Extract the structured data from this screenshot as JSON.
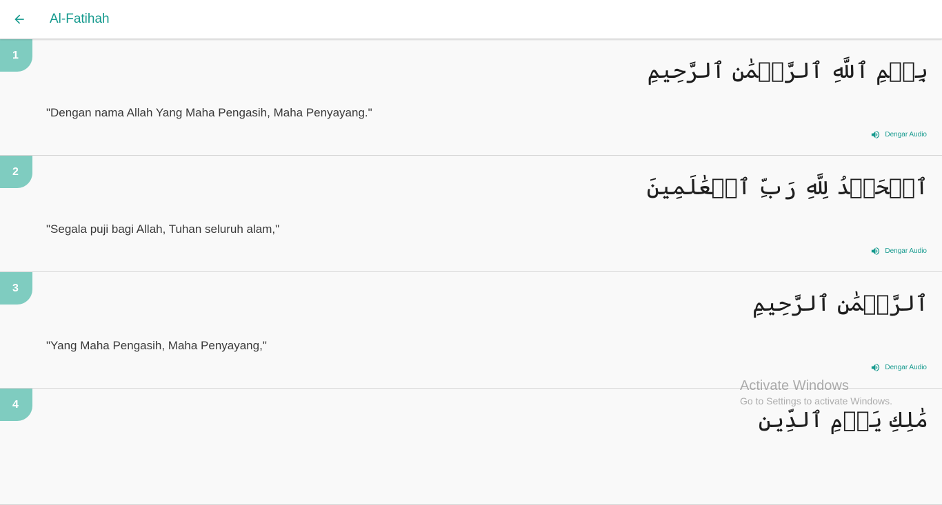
{
  "header": {
    "title": "Al-Fatihah",
    "back_icon": "arrow-left-icon"
  },
  "colors": {
    "accent": "#169a8e",
    "badge": "#7fccc0",
    "background": "#f9f9f9"
  },
  "ayahs": [
    {
      "number": "1",
      "arabic": "بِسۡمِ ٱللَّهِ ٱلرَّحۡمَٰنِ ٱلرَّحِيمِ",
      "translation": "\"Dengan nama Allah Yang Maha Pengasih, Maha Penyayang.\"",
      "audio_label": "Dengar Audio"
    },
    {
      "number": "2",
      "arabic": "ٱلۡحَمۡدُ لِلَّهِ رَبِّ ٱلۡعَٰلَمِينَ",
      "translation": "\"Segala puji bagi Allah, Tuhan seluruh alam,\"",
      "audio_label": "Dengar Audio"
    },
    {
      "number": "3",
      "arabic": "ٱلرَّحۡمَٰنِ ٱلرَّحِيمِ",
      "translation": "\"Yang Maha Pengasih, Maha Penyayang,\"",
      "audio_label": "Dengar Audio"
    },
    {
      "number": "4",
      "arabic": "مَٰلِكِ يَوۡمِ ٱلدِّينِ",
      "translation": "",
      "audio_label": ""
    }
  ],
  "watermark": {
    "title": "Activate Windows",
    "subtitle": "Go to Settings to activate Windows."
  }
}
